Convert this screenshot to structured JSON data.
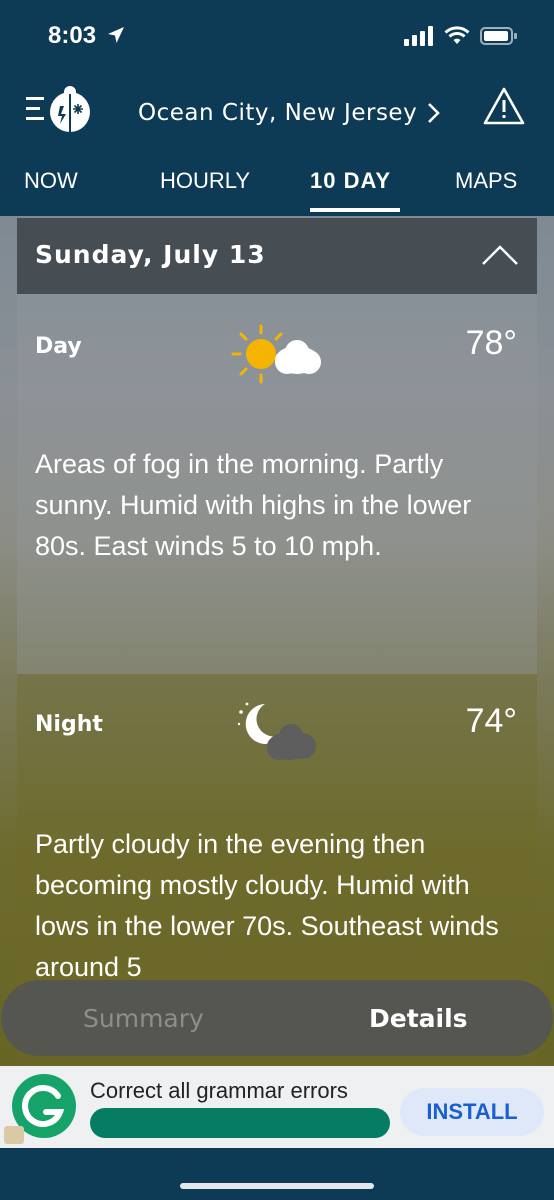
{
  "status_bar": {
    "time": "8:03"
  },
  "header": {
    "location": "Ocean City, New Jersey"
  },
  "tabs": [
    {
      "label": "NOW"
    },
    {
      "label": "HOURLY"
    },
    {
      "label": "10 DAY"
    },
    {
      "label": "MAPS"
    }
  ],
  "day_card": {
    "date": "Sunday, July 13",
    "day": {
      "label": "Day",
      "temp": "78°",
      "icon": "partly-sunny-icon",
      "text": "Areas of fog in the morning. Partly sunny. Humid with highs in the lower 80s. East winds 5 to 10 mph."
    },
    "night": {
      "label": "Night",
      "temp": "74°",
      "icon": "partly-cloudy-night-icon",
      "text": "Partly cloudy in the evening then becoming mostly cloudy. Humid with lows in the lower 70s. Southeast winds around 5"
    }
  },
  "view_toggle": {
    "summary": "Summary",
    "details": "Details",
    "selected": "Details"
  },
  "ad": {
    "title": "Correct all grammar errors",
    "install": "INSTALL"
  },
  "colors": {
    "header_bg": "#0d3a54",
    "accent_sun": "#f5b400",
    "ad_green": "#067c63",
    "install_blue": "#1a5fd1"
  }
}
